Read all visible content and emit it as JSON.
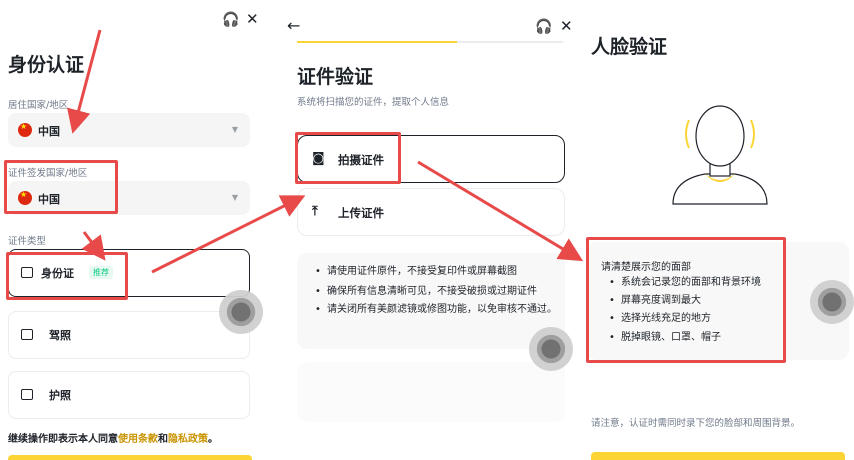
{
  "panel1": {
    "title": "身份认证",
    "residence_label": "居住国家/地区",
    "residence_value": "中国",
    "issuing_label": "证件签发国家/地区",
    "issuing_value": "中国",
    "doc_type_label": "证件类型",
    "options": [
      {
        "label": "身份证",
        "badge": "推荐"
      },
      {
        "label": "驾照"
      },
      {
        "label": "护照"
      }
    ],
    "footer_prefix": "继续操作即表示本人同意",
    "footer_link1": "使用条款",
    "footer_and": "和",
    "footer_link2": "隐私政策",
    "footer_suffix": "。"
  },
  "panel2": {
    "title": "证件验证",
    "subtitle": "系统将扫描您的证件，提取个人信息",
    "take_photo": "拍摄证件",
    "upload": "上传证件",
    "tips": [
      "请使用证件原件，不接受复印件或屏幕截图",
      "确保所有信息清晰可见，不接受破损或过期证件",
      "请关闭所有美颜滤镜或修图功能，以免审核不通过。"
    ]
  },
  "panel3": {
    "title": "人脸验证",
    "tips_heading": "请清楚展示您的面部",
    "tips": [
      "系统会记录您的面部和背景环境",
      "屏幕亮度调到最大",
      "选择光线充足的地方",
      "脱掉眼镜、口罩、帽子"
    ],
    "notice": "请注意，认证时需同时录下您的脸部和周围背景。"
  },
  "colors": {
    "accent_yellow": "#fcd535",
    "annotation_red": "#e84a4a",
    "link_gold": "#c99400",
    "badge_green": "#0ecb81"
  },
  "icons": [
    "headset-icon",
    "close-icon",
    "back-arrow-icon",
    "camera-icon",
    "upload-icon",
    "id-card-icon",
    "driver-license-icon",
    "passport-icon",
    "chevron-down-icon"
  ]
}
